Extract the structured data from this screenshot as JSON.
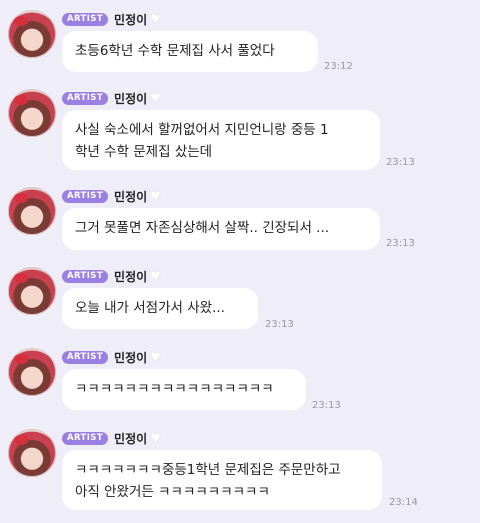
{
  "badge_label": "ARTIST",
  "messages": [
    {
      "name": "민정이",
      "text": "초등6학년 수학 문제집 사서 풀었다",
      "time": "23:12"
    },
    {
      "name": "민정이",
      "text": "사실 숙소에서 할꺼없어서 지민언니랑 중등 1",
      "text2": "학년 수학 문제집 샀는데",
      "time": "23:13"
    },
    {
      "name": "민정이",
      "text": "그거 못풀면 자존심상해서 살짝.. 긴장되서 ...",
      "time": "23:13"
    },
    {
      "name": "민정이",
      "text": "오늘 내가 서점가서 사왔...",
      "time": "23:13"
    },
    {
      "name": "민정이",
      "text": "ㅋㅋㅋㅋㅋㅋㅋㅋㅋㅋㅋㅋㅋㅋㅋㅋ",
      "time": "23:13"
    },
    {
      "name": "민정이",
      "text": "ㅋㅋㅋㅋㅋㅋㅋ중등1학년 문제집은 주문만하고",
      "text2": "아직 안왔거든 ㅋㅋㅋㅋㅋㅋㅋㅋㅋ",
      "time": "23:14"
    }
  ],
  "icons": {
    "avatar": "profile-avatar",
    "heart": "heart-icon"
  }
}
